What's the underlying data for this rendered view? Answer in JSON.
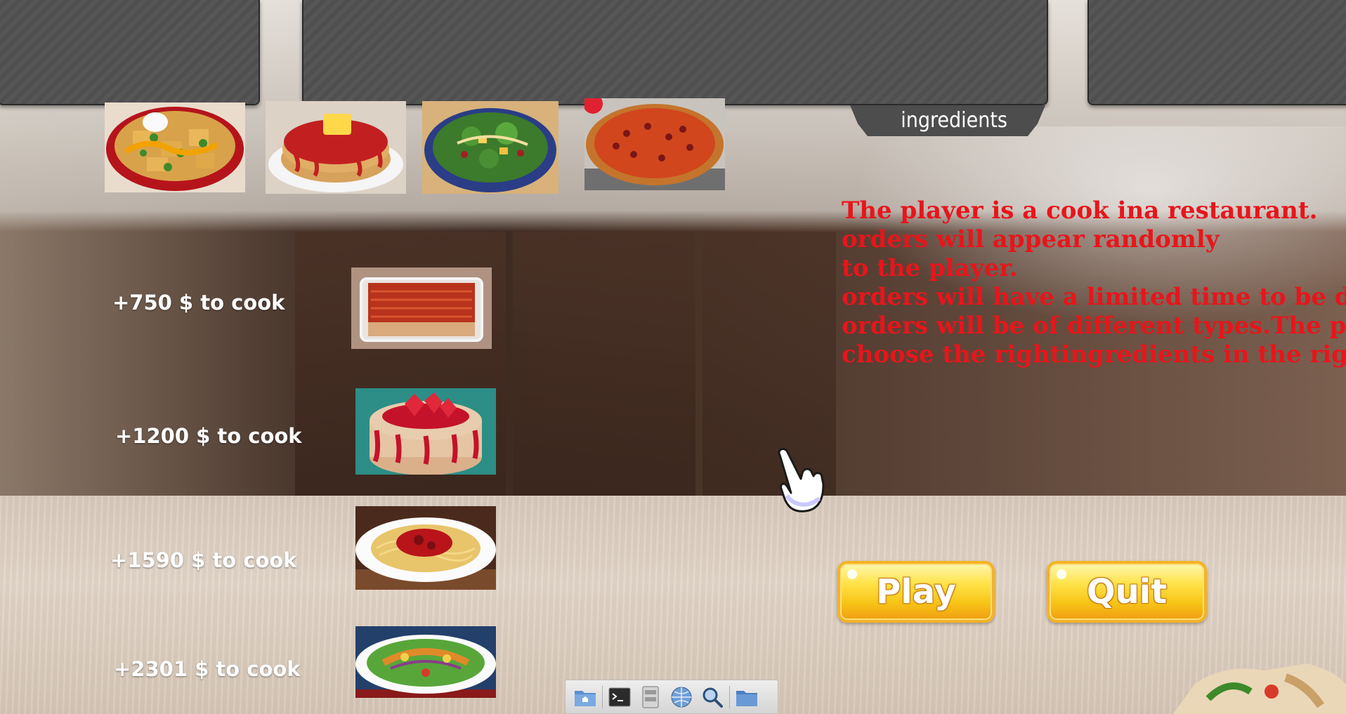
{
  "top_panel": {
    "tag_label": "ingredients"
  },
  "menu_items": [
    {
      "price_label": "+750 $ to cook",
      "dish": "lasagna-in-glass-dish"
    },
    {
      "price_label": "+1200 $ to cook",
      "dish": "strawberry-pancakes"
    },
    {
      "price_label": "+1590 $ to cook",
      "dish": "spaghetti-with-sauce"
    },
    {
      "price_label": "+2301 $ to cook",
      "dish": "chicken-salad"
    }
  ],
  "top_dishes": [
    "nachos",
    "syrup-pancakes",
    "salad-bowl",
    "pizza"
  ],
  "description": {
    "lines": [
      "The player is a cook ina restaurant.",
      "orders will appear randomly",
      "to the player.",
      "orders will have a limited time to be done.",
      "orders will be of different types.The player",
      "choose the rightingredients in the right o"
    ],
    "color": "#e8151b"
  },
  "buttons": {
    "play_label": "Play",
    "quit_label": "Quit"
  },
  "taskbar": {
    "items": [
      "home-folder-icon",
      "terminal-icon",
      "file-manager-icon",
      "web-browser-icon",
      "search-icon",
      "folder-icon"
    ]
  }
}
